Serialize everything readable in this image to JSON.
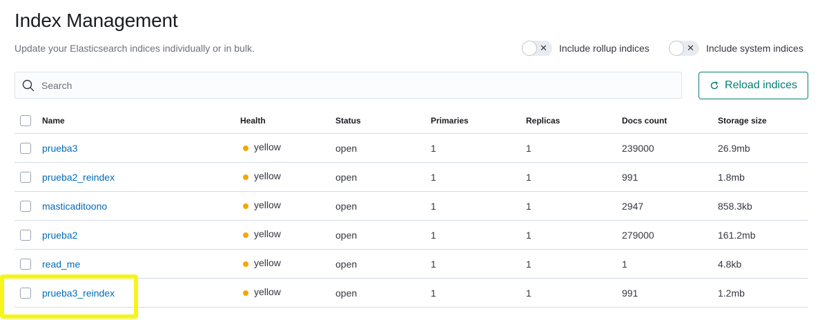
{
  "page": {
    "title": "Index Management",
    "subtitle": "Update your Elasticsearch indices individually or in bulk."
  },
  "toggles": {
    "rollup_label": "Include rollup indices",
    "system_label": "Include system indices"
  },
  "search": {
    "placeholder": "Search",
    "value": ""
  },
  "reload_button": {
    "label": "Reload indices"
  },
  "table": {
    "columns": [
      "Name",
      "Health",
      "Status",
      "Primaries",
      "Replicas",
      "Docs count",
      "Storage size"
    ],
    "rows": [
      {
        "name": "prueba3",
        "health": "yellow",
        "status": "open",
        "primaries": "1",
        "replicas": "1",
        "docs": "239000",
        "storage": "26.9mb"
      },
      {
        "name": "prueba2_reindex",
        "health": "yellow",
        "status": "open",
        "primaries": "1",
        "replicas": "1",
        "docs": "991",
        "storage": "1.8mb"
      },
      {
        "name": "masticaditoono",
        "health": "yellow",
        "status": "open",
        "primaries": "1",
        "replicas": "1",
        "docs": "2947",
        "storage": "858.3kb"
      },
      {
        "name": "prueba2",
        "health": "yellow",
        "status": "open",
        "primaries": "1",
        "replicas": "1",
        "docs": "279000",
        "storage": "161.2mb"
      },
      {
        "name": "read_me",
        "health": "yellow",
        "status": "open",
        "primaries": "1",
        "replicas": "1",
        "docs": "1",
        "storage": "4.8kb"
      },
      {
        "name": "prueba3_reindex",
        "health": "yellow",
        "status": "open",
        "primaries": "1",
        "replicas": "1",
        "docs": "991",
        "storage": "1.2mb"
      }
    ]
  },
  "colors": {
    "accent": "#017d73",
    "link": "#006bb8",
    "health_yellow": "#f5a700",
    "highlight": "#f6f41a"
  }
}
